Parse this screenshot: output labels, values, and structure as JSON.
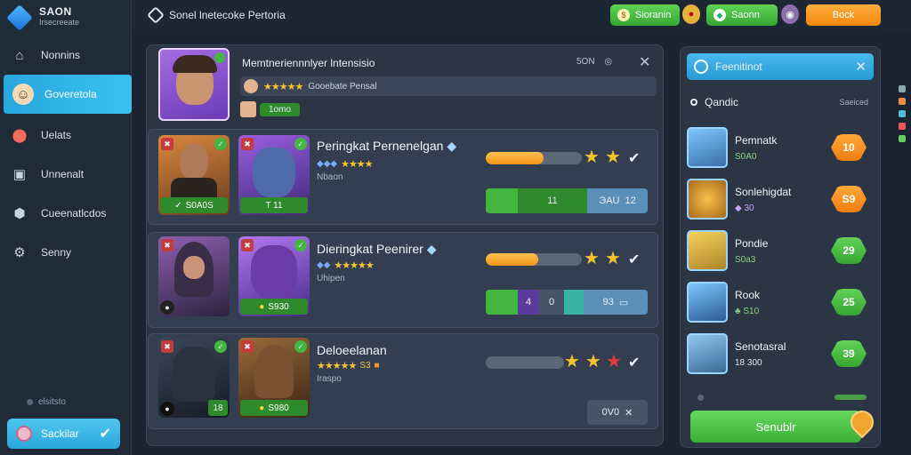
{
  "app": {
    "brand": "SAON",
    "brand_sub": "Irsecreeate",
    "title": "Sonel lnetecoke Pertoria"
  },
  "sidebar": {
    "items": [
      {
        "label": "Nonnins",
        "icon": "home-icon"
      },
      {
        "label": "Goveretola",
        "icon": "user-icon"
      },
      {
        "label": "Uelats",
        "icon": "location-icon"
      },
      {
        "label": "Unnenalt",
        "icon": "panel-icon"
      },
      {
        "label": "Cueenatlcdos",
        "icon": "hexagon-icon"
      },
      {
        "label": "Senny",
        "icon": "gear-icon"
      }
    ],
    "status": "elsitsto",
    "select_label": "Sackilar"
  },
  "topbar": {
    "currency1": "Sioranin",
    "currency2": "Saonn",
    "action": "Bock"
  },
  "header": {
    "title": "Memtneriennnlyer lntensisio",
    "rating_label": "Gooebate Pensal",
    "tag": "1omo",
    "meta": "5ON"
  },
  "rows": [
    {
      "title": "Peringkat Pernenelgan",
      "sub": "Nbaon",
      "card1_tag": "S0A0S",
      "card2_tag": "T 11",
      "seg_left": "11",
      "seg_right": "ЭАU",
      "seg_right2": "12",
      "progress": 0.6,
      "gold_stars": 2,
      "red_stars": 0
    },
    {
      "title": "Dieringkat Peenirer",
      "sub": "Uhipen",
      "card1_tag": "",
      "card2_tag": "S930",
      "seg_left": "4",
      "seg_mid": "0",
      "seg_right": "93",
      "progress": 0.55,
      "gold_stars": 2,
      "red_stars": 0
    },
    {
      "title": "Deloeelanan",
      "sub": "Iraspo",
      "rating_extra": "S3",
      "card1_tag": "18",
      "card2_tag": "S980",
      "seg_right": "0V0",
      "progress": 0.0,
      "gold_stars": 2,
      "red_stars": 1
    }
  ],
  "right_panel": {
    "title": "Feenitinot",
    "subtitle": "Qandic",
    "subtitle_meta": "Saeiced",
    "items": [
      {
        "name": "Pemnatk",
        "value": "S0A0",
        "badge": "10",
        "badge_color": "orange"
      },
      {
        "name": "Sonlehigdat",
        "value": "30",
        "badge": "S9",
        "badge_color": "orange"
      },
      {
        "name": "Pondie",
        "value": "S0a3",
        "badge": "29",
        "badge_color": "green"
      },
      {
        "name": "Rook",
        "value": "S10",
        "badge": "25",
        "badge_color": "green"
      },
      {
        "name": "Senotasral",
        "value": "18 300",
        "badge": "39",
        "badge_color": "green"
      }
    ],
    "submit": "Senublr"
  }
}
